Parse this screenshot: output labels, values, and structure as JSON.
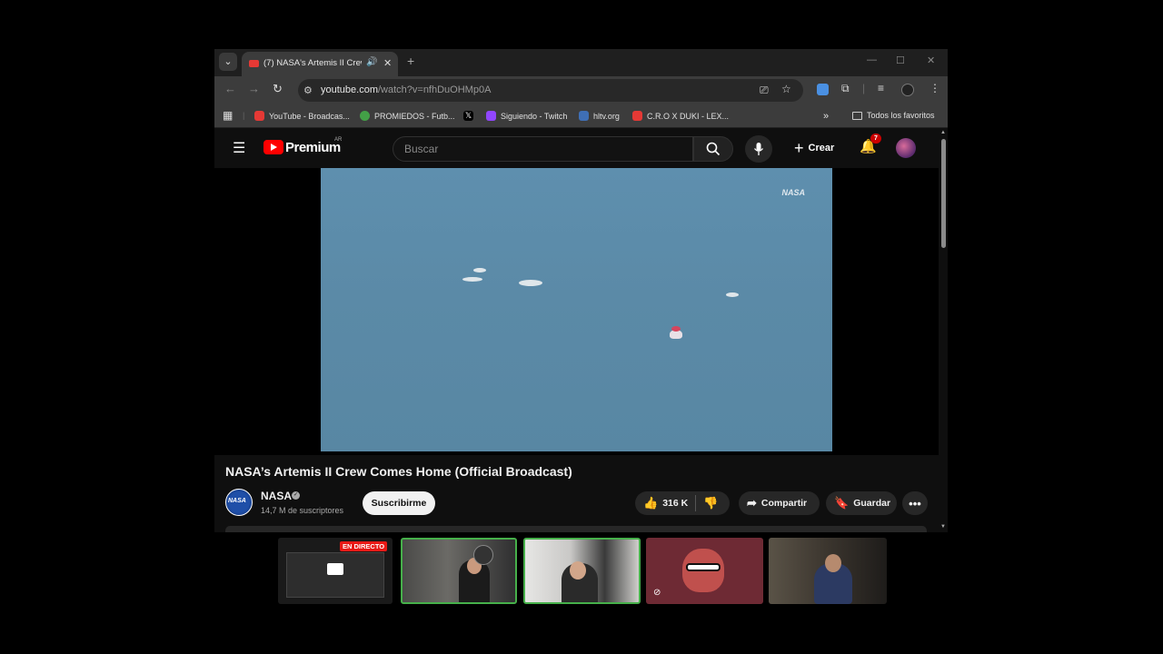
{
  "browser": {
    "tab_title": "(7) NASA's Artemis II Crew",
    "url_host": "youtube.com",
    "url_path": "/watch?v=nfhDuOHMp0A",
    "bookmarks": [
      {
        "label": "YouTube - Broadcas...",
        "color": "#e53935"
      },
      {
        "label": "PROMIEDOS - Futb...",
        "color": "#43a047"
      },
      {
        "label": "",
        "color": "#000000"
      },
      {
        "label": "Siguiendo - Twitch",
        "color": "#9146ff"
      },
      {
        "label": "hltv.org",
        "color": "#3f6fb5"
      },
      {
        "label": "C.R.O X DUKI - LEX...",
        "color": "#e53935"
      }
    ],
    "all_bookmarks": "Todos los favoritos"
  },
  "youtube": {
    "brand": "Premium",
    "region": "AR",
    "search_placeholder": "Buscar",
    "create_label": "Crear",
    "notif_count": "7"
  },
  "video": {
    "watermark": "NASA",
    "title": "NASA’s Artemis II Crew Comes Home (Official Broadcast)",
    "channel": "NASA",
    "channel_avatar_text": "NASA",
    "subscribers": "14,7 M de suscriptores",
    "subscribe_label": "Suscribirme",
    "likes": "316 K",
    "share_label": "Compartir",
    "save_label": "Guardar"
  },
  "stream": {
    "live_badge": "EN DIRECTO"
  },
  "colors": {
    "yt_red": "#ff0000",
    "ocean": "#5b8aa7",
    "live_red": "#e91916",
    "cam_active_border": "#46b04a"
  }
}
